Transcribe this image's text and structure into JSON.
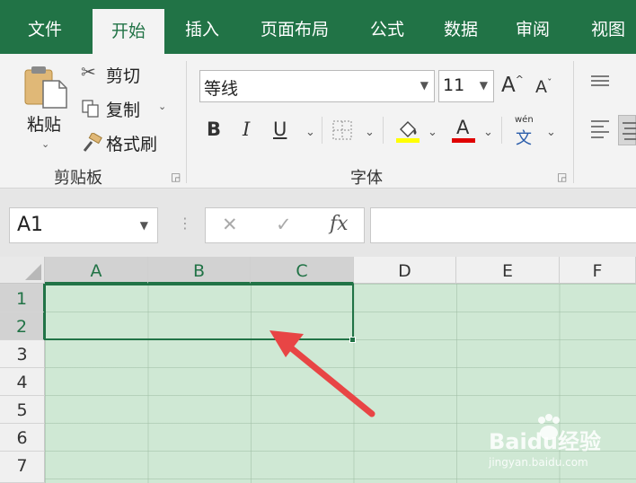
{
  "ribbon_tabs": [
    "文件",
    "开始",
    "插入",
    "页面布局",
    "公式",
    "数据",
    "审阅",
    "视图"
  ],
  "active_tab": "开始",
  "clipboard": {
    "paste_label": "粘贴",
    "cut_label": "剪切",
    "copy_label": "复制",
    "format_painter_label": "格式刷",
    "group_label": "剪贴板"
  },
  "font": {
    "font_name": "等线",
    "font_size": "11",
    "grow_label": "A",
    "shrink_label": "A",
    "bold_label": "B",
    "italic_label": "I",
    "underline_label": "U",
    "font_color_label": "A",
    "phonetic_label": "wén",
    "phonetic_char": "文",
    "group_label": "字体"
  },
  "formula_bar": {
    "name_box": "A1",
    "cancel_symbol": "✕",
    "enter_symbol": "✓",
    "fx_label": "fx",
    "content": ""
  },
  "grid": {
    "columns": [
      "A",
      "B",
      "C",
      "D",
      "E",
      "F"
    ],
    "selected_columns": [
      "A",
      "B",
      "C"
    ],
    "rows": [
      "1",
      "2",
      "3",
      "4",
      "5",
      "6",
      "7"
    ],
    "selected_rows": [
      "1",
      "2"
    ],
    "cell_fill": "#cfe8d4"
  },
  "accent_color": "#217346",
  "arrow_color": "#e84545",
  "watermark": {
    "brand": "Baidu经验",
    "url": "jingyan.baidu.com"
  }
}
